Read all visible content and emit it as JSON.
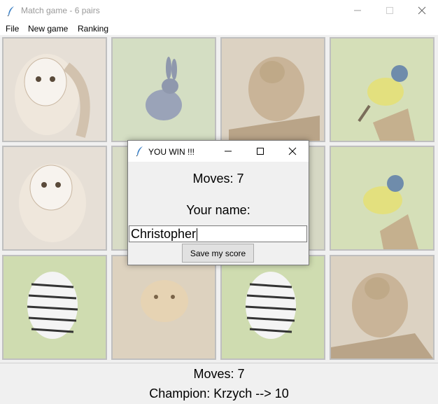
{
  "window": {
    "title": "Match game - 6 pairs"
  },
  "menu": {
    "items": [
      "File",
      "New game",
      "Ranking"
    ]
  },
  "tiles": [
    {
      "animal": "owl"
    },
    {
      "animal": "rabbit"
    },
    {
      "animal": "monkey"
    },
    {
      "animal": "bird"
    },
    {
      "animal": "owl"
    },
    {
      "animal": "hidden"
    },
    {
      "animal": "hidden"
    },
    {
      "animal": "bird"
    },
    {
      "animal": "zebra"
    },
    {
      "animal": "lion-cub"
    },
    {
      "animal": "zebra"
    },
    {
      "animal": "monkey"
    }
  ],
  "status": {
    "moves": "Moves: 7",
    "champion": "Champion: Krzych --> 10"
  },
  "dialog": {
    "title": "YOU WIN !!!",
    "moves": "Moves: 7",
    "name_label": "Your name:",
    "name_value": "Christopher",
    "save_label": "Save my score"
  },
  "colors": {
    "tile_bg": "#d8dcc6",
    "tile_green": "#c9d6a8",
    "accent": "#0078d7"
  }
}
